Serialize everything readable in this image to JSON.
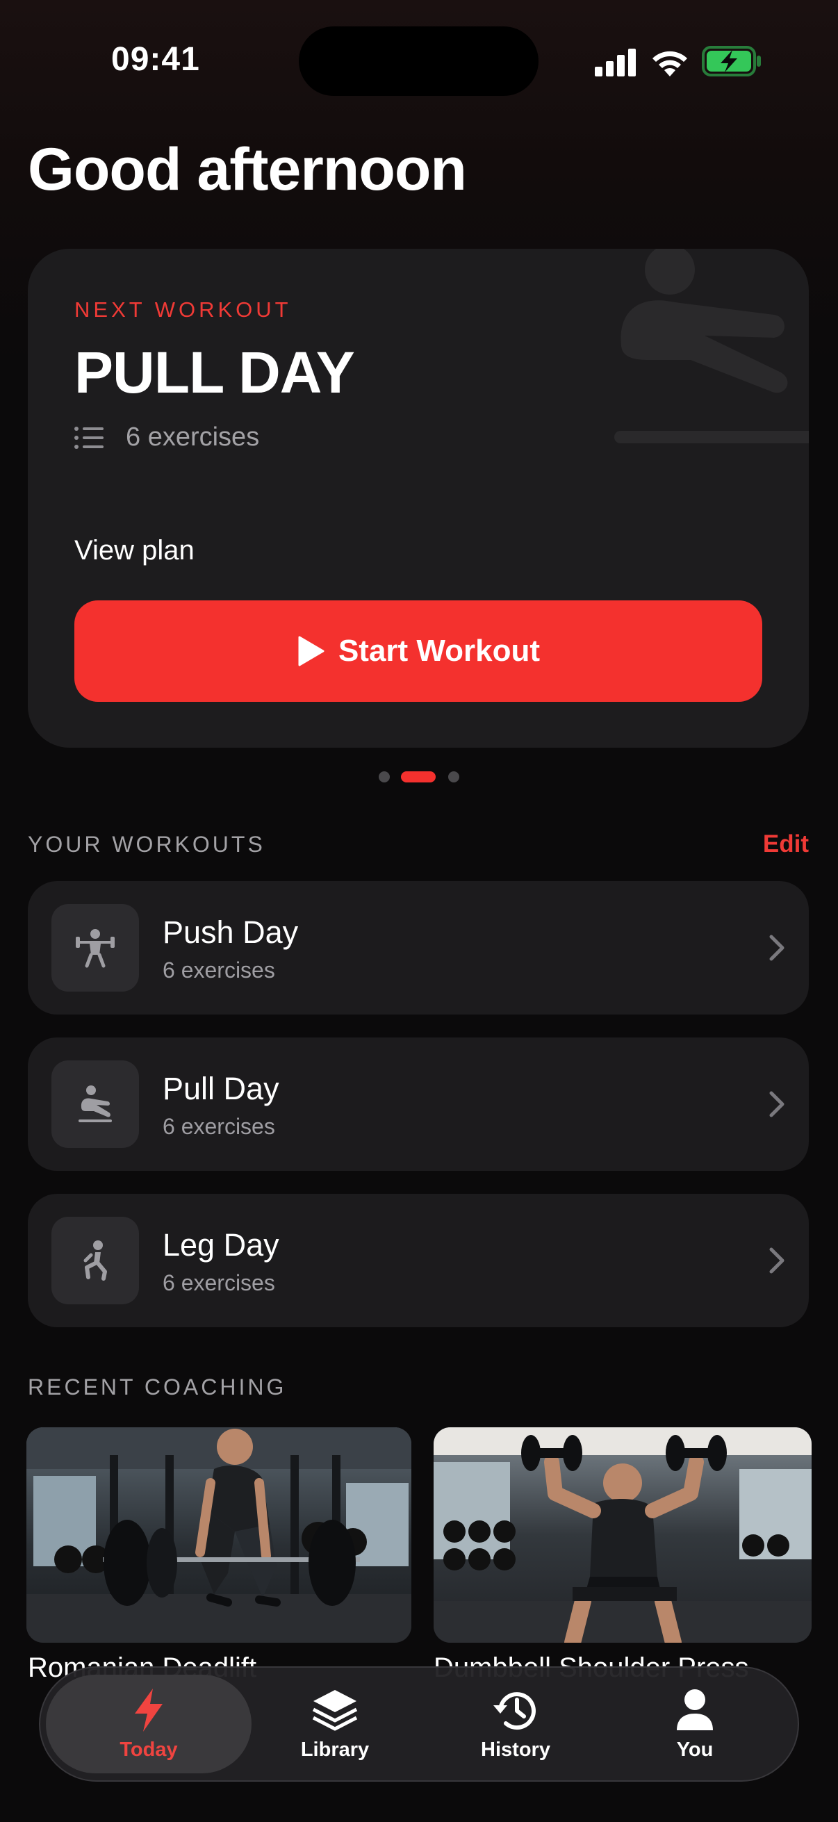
{
  "status_bar": {
    "time": "09:41"
  },
  "greeting": "Good afternoon",
  "hero": {
    "eyebrow": "NEXT WORKOUT",
    "title": "PULL DAY",
    "meta": "6 exercises",
    "view_plan": "View plan",
    "start_label": "Start Workout"
  },
  "carousel": {
    "count": 3,
    "active_index": 1
  },
  "your_workouts": {
    "title": "YOUR WORKOUTS",
    "edit": "Edit",
    "items": [
      {
        "name": "Push Day",
        "sub": "6 exercises",
        "icon": "bench-press-icon"
      },
      {
        "name": "Pull Day",
        "sub": "6 exercises",
        "icon": "rowing-icon"
      },
      {
        "name": "Leg Day",
        "sub": "6 exercises",
        "icon": "lunge-icon"
      }
    ]
  },
  "recent_coaching": {
    "title": "RECENT COACHING",
    "cards": [
      {
        "label": "Romanian Deadlift"
      },
      {
        "label": "Dumbbell Shoulder Press"
      }
    ]
  },
  "tabs": [
    {
      "label": "Today",
      "icon": "bolt-icon",
      "active": true
    },
    {
      "label": "Library",
      "icon": "layers-icon",
      "active": false
    },
    {
      "label": "History",
      "icon": "history-icon",
      "active": false
    },
    {
      "label": "You",
      "icon": "person-icon",
      "active": false
    }
  ],
  "colors": {
    "accent": "#f4312e",
    "card": "#1d1c1e",
    "background": "#0b0a0b",
    "battery": "#34c759"
  }
}
